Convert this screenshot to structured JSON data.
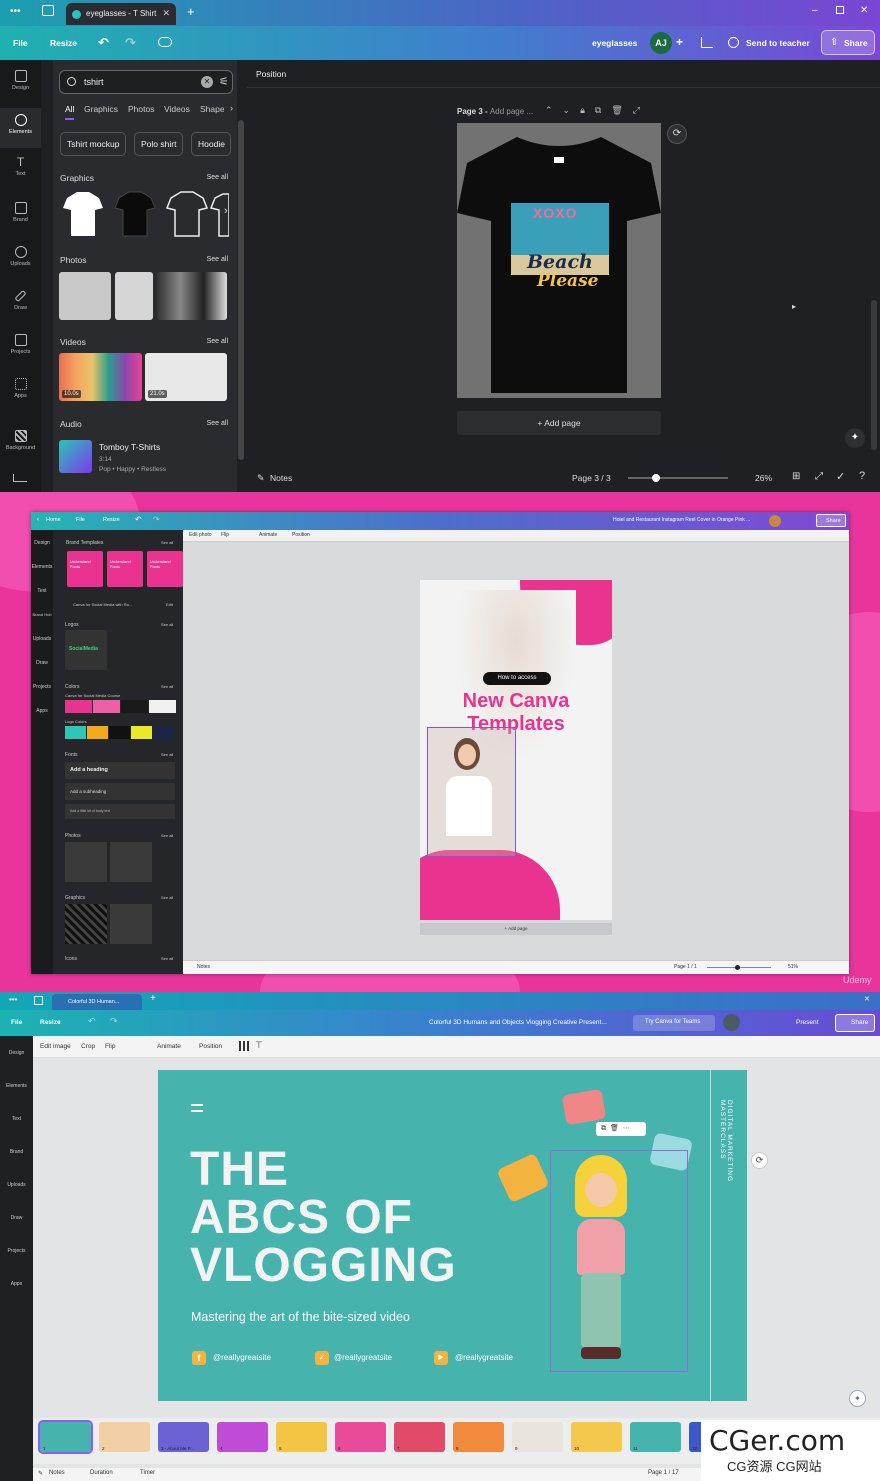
{
  "panel1": {
    "tab_title": "eyeglasses - T Shirt",
    "menu": {
      "file": "File",
      "resize": "Resize"
    },
    "doc_name": "eyeglasses",
    "avatar": "AJ",
    "send_to_teacher": "Send to teacher",
    "share": "Share",
    "rail": [
      "Design",
      "Elements",
      "Text",
      "Brand",
      "Uploads",
      "Draw",
      "Projects",
      "Apps",
      "Background"
    ],
    "search_value": "tshirt",
    "filter_tabs": [
      "All",
      "Graphics",
      "Photos",
      "Videos",
      "Shape"
    ],
    "suggestions": [
      "Tshirt mockup",
      "Polo shirt",
      "Hoodie"
    ],
    "sections": {
      "graphics": "Graphics",
      "photos": "Photos",
      "videos": "Videos",
      "audio": "Audio",
      "see_all": "See all"
    },
    "video_durations": [
      "10.0s",
      "21.0s"
    ],
    "audio": {
      "title": "Tomboy T-Shirts",
      "duration": "3:14",
      "tags": "Pop • Happy • Restless"
    },
    "position_label": "Position",
    "page_label": "Page 3 - ",
    "page_title_placeholder": "Add page ...",
    "shirt_text": {
      "top": "XOXO",
      "bottom1": "Beach",
      "bottom2": "Please"
    },
    "add_page": "+ Add page",
    "notes": "Notes",
    "page_counter": "Page 3 / 3",
    "zoom": "26%",
    "zoom_fraction": 0.26
  },
  "panel2": {
    "menu": {
      "home": "Home",
      "file": "File",
      "resize": "Resize"
    },
    "title": "Hotel and Restaurant Instagram Reel Cover in Orange Pink ...",
    "share": "Share",
    "toolbar": [
      "Edit photo",
      "Flip",
      "Animate",
      "Position"
    ],
    "sidebar_header": "Brand Templates",
    "kit": "Canva for Social Media with Ro...",
    "kit_edit": "Edit",
    "sections": [
      "Logos",
      "Colors",
      "Fonts",
      "Photos",
      "Graphics",
      "Icons"
    ],
    "see_all": "See all",
    "colors_label": "Canva for Social Media Course",
    "logo_colors_label": "Logo Colors",
    "font_items": [
      "Add a heading",
      "Add a subheading",
      "Add a little bit of body text"
    ],
    "template_text": "Understand Fonts",
    "logo_text": "SocialMedia",
    "pill": "How to access",
    "headline1": "New Canva",
    "headline2": "Templates",
    "add_page": "+ Add page",
    "notes": "Notes",
    "page_counter": "Page 1 / 1",
    "zoom": "51%",
    "watermark": "Udemy",
    "rail": [
      "Design",
      "Elements",
      "Text",
      "Brand Hub",
      "Uploads",
      "Draw",
      "Projects",
      "Apps"
    ],
    "colors": [
      "#e8338f",
      "#ec5fa7",
      "#1a1a1a",
      "#f0f0f0"
    ],
    "logo_colors": [
      "#2ec6b8",
      "#f2a91a",
      "#111111",
      "#e9e92a",
      "#1c2448"
    ]
  },
  "panel3": {
    "tab_title": "Colorful 3D Human...",
    "menu": {
      "file": "File",
      "resize": "Resize"
    },
    "title": "Colorful 3D Humans and Objects Vlogging Creative Present...",
    "try_teams": "Try Canva for Teams",
    "present": "Present",
    "share": "Share",
    "toolbar": [
      "Edit image",
      "Crop",
      "Flip",
      "Animate",
      "Position"
    ],
    "rail": [
      "Design",
      "Elements",
      "Text",
      "Brand",
      "Uploads",
      "Draw",
      "Projects",
      "Apps"
    ],
    "slide": {
      "line1": "THE",
      "line2": "ABCS OF",
      "line3": "VLOGGING",
      "subtitle": "Mastering the art of the bite-sized video",
      "vertical": "DIGITAL MARKETING MASTERCLASS",
      "social": [
        "@reallygreatsite",
        "@reallygreatsite",
        "@reallygreatsite"
      ]
    },
    "thumbnails": [
      {
        "label": "1",
        "color": "#47b3ad"
      },
      {
        "label": "2",
        "color": "#f3cfa5"
      },
      {
        "label": "3 - About Me P...",
        "color": "#6b62d6"
      },
      {
        "label": "4",
        "color": "#c04bd6"
      },
      {
        "label": "5",
        "color": "#f4c542"
      },
      {
        "label": "6",
        "color": "#e94b9a"
      },
      {
        "label": "7",
        "color": "#e24a6a"
      },
      {
        "label": "8",
        "color": "#f18a3c"
      },
      {
        "label": "9",
        "color": "#e9e4dc"
      },
      {
        "label": "10",
        "color": "#f3c84c"
      },
      {
        "label": "11",
        "color": "#47b3ad"
      },
      {
        "label": "12",
        "color": "#3c58c8"
      },
      {
        "label": "13",
        "color": "#f0d24a"
      }
    ],
    "notes": "Notes",
    "duration": "Duration",
    "timer": "Timer",
    "page_counter": "Page 1 / 17",
    "watermark_main": "CGer.com",
    "watermark_sub": "CG资源 CG网站"
  }
}
